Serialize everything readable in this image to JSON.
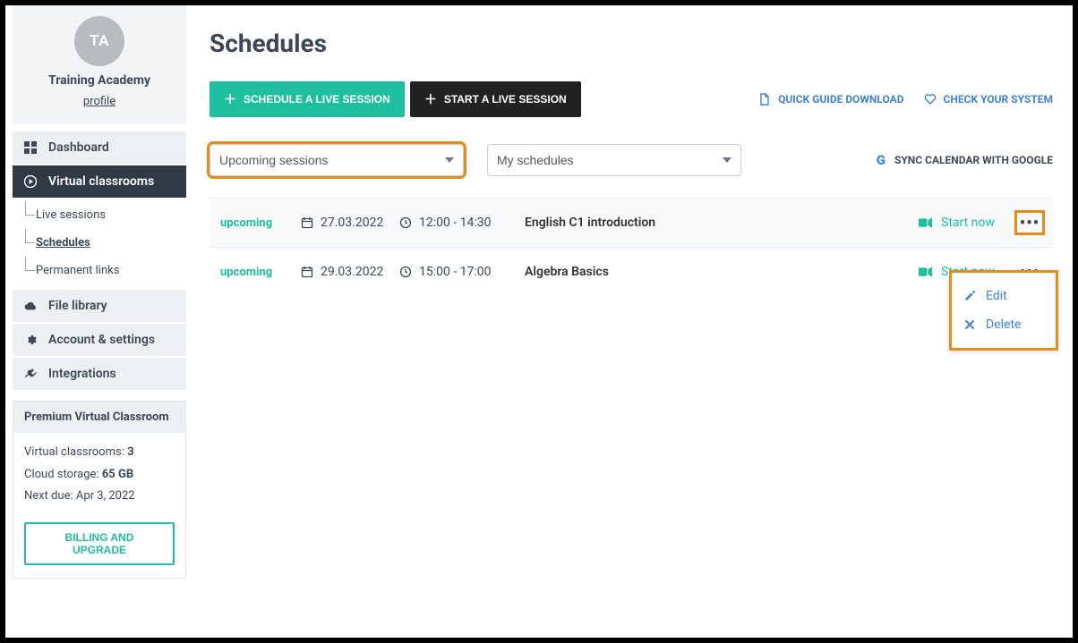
{
  "profile": {
    "initials": "TA",
    "name": "Training Academy",
    "link": "profile"
  },
  "nav": {
    "dashboard": "Dashboard",
    "virtual_classrooms": "Virtual classrooms",
    "sub": {
      "live_sessions": "Live sessions",
      "schedules": "Schedules",
      "permanent_links": "Permanent links"
    },
    "file_library": "File library",
    "account_settings": "Account & settings",
    "integrations": "Integrations"
  },
  "plan": {
    "title": "Premium Virtual Classroom",
    "rooms_label": "Virtual classrooms: ",
    "rooms_value": "3",
    "storage_label": "Cloud storage: ",
    "storage_value": "65 GB",
    "due_label": "Next due: ",
    "due_value": "Apr 3, 2022",
    "billing_btn": "BILLING AND UPGRADE"
  },
  "page": {
    "title": "Schedules",
    "btn_schedule": "SCHEDULE A LIVE SESSION",
    "btn_start": "START A LIVE SESSION",
    "link_guide": "QUICK GUIDE DOWNLOAD",
    "link_check": "CHECK YOUR SYSTEM",
    "filter_sessions": "Upcoming sessions",
    "filter_schedules": "My schedules",
    "sync": "SYNC CALENDAR WITH GOOGLE"
  },
  "sessions": [
    {
      "status": "upcoming",
      "date": "27.03.2022",
      "time": "12:00 - 14:30",
      "title": "English C1 introduction",
      "action": "Start now"
    },
    {
      "status": "upcoming",
      "date": "29.03.2022",
      "time": "15:00 - 17:00",
      "title": "Algebra Basics",
      "action": "Start now"
    }
  ],
  "popover": {
    "edit": "Edit",
    "delete": "Delete"
  }
}
